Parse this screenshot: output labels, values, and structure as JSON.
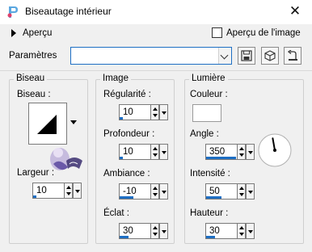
{
  "window": {
    "title": "Biseautage intérieur"
  },
  "preview": {
    "label": "Aperçu",
    "image_preview_label": "Aperçu de l'image"
  },
  "presets": {
    "label": "Paramètres",
    "value": ""
  },
  "bevel_group": {
    "title": "Biseau",
    "bevel_label": "Biseau :",
    "width_label": "Largeur :",
    "width_value": "10",
    "width_fraction": 0.1
  },
  "image_group": {
    "title": "Image",
    "smoothness_label": "Régularité :",
    "smoothness_value": "10",
    "smoothness_fraction": 0.1,
    "depth_label": "Profondeur :",
    "depth_value": "10",
    "depth_fraction": 0.1,
    "ambience_label": "Ambiance :",
    "ambience_value": "-10",
    "ambience_fraction": 0.45,
    "shininess_label": "Éclat :",
    "shininess_value": "30",
    "shininess_fraction": 0.3
  },
  "light_group": {
    "title": "Lumière",
    "color_label": "Couleur :",
    "color_value": "#ffffff",
    "angle_label": "Angle :",
    "angle_value": "350",
    "angle_fraction": 0.97,
    "intensity_label": "Intensité :",
    "intensity_value": "50",
    "intensity_fraction": 0.5,
    "elevation_label": "Hauteur :",
    "elevation_value": "30",
    "elevation_fraction": 0.3
  },
  "colors": {
    "accent": "#1e6fc4"
  },
  "icons": [
    "app-logo-icon",
    "close-icon",
    "expand-triangle-icon",
    "save-icon",
    "presets-cube-icon",
    "reset-icon",
    "bevel-shape-icon",
    "watermark-logo"
  ]
}
